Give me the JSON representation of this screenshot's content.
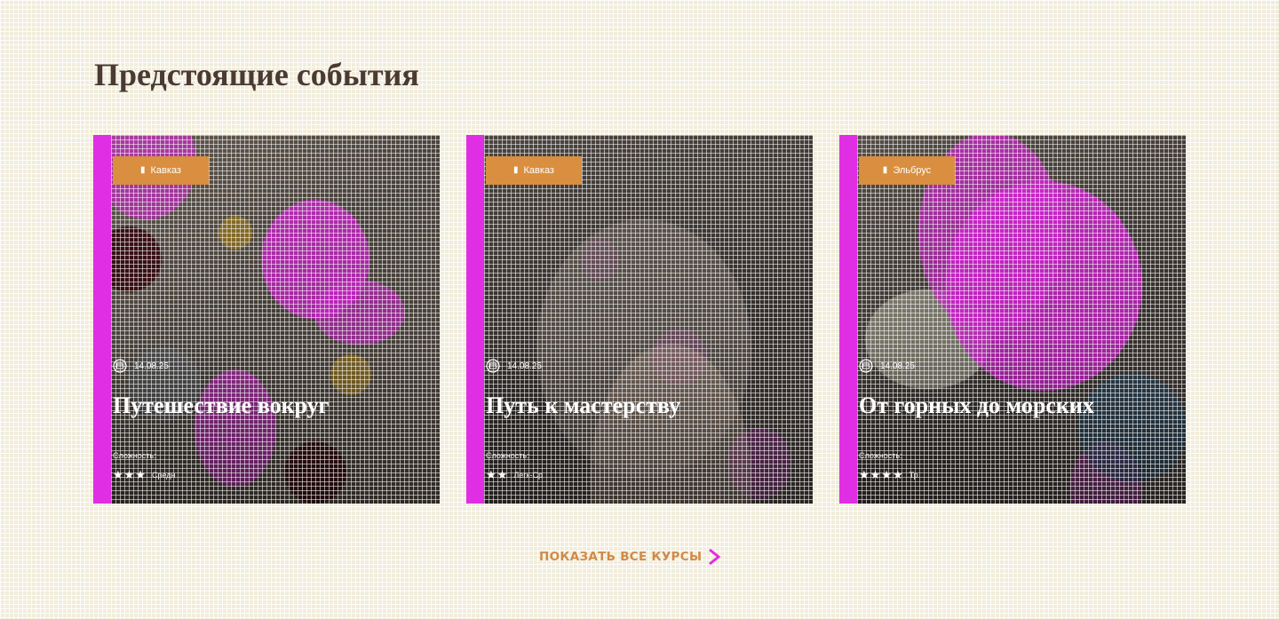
{
  "page": {
    "title": "Предстоящие события"
  },
  "cards": [
    {
      "category": "Кавказ",
      "date": "14.08.25",
      "title": "Путешествие вокруг",
      "difficulty_label": "Сложность:",
      "stars": "★★★",
      "level": "Средн"
    },
    {
      "category": "Кавказ",
      "date": "14.08.25",
      "title": "Путь к мастерству",
      "difficulty_label": "Сложность:",
      "stars": "★★",
      "level": "Легк-Ср"
    },
    {
      "category": "Эльбрус",
      "date": "14.08.25",
      "title": "От горных до морских",
      "difficulty_label": "Сложность:",
      "stars": "★★★★",
      "level": "Тр"
    }
  ],
  "show_all": {
    "label": "ПОКАЗАТЬ ВСЕ КУРСЫ"
  },
  "colors": {
    "background": "#f1eddb",
    "title": "#4a3a32",
    "badge": "#d98f3f",
    "stripe": "#df2ee3",
    "link": "#d08a4a",
    "chevron": "#df2ee3"
  },
  "icons": {
    "badge": "location-pin-icon",
    "date": "calendar-icon",
    "difficulty": "star-icon",
    "link": "chevron-right-icon"
  }
}
